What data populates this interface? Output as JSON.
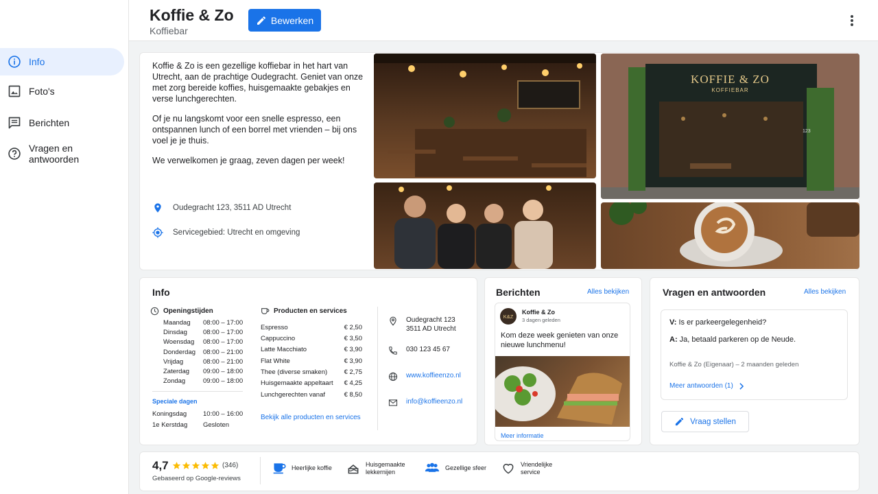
{
  "business": {
    "name": "Koffie & Zo",
    "category": "Koffiebar",
    "edit_label": "Bewerken"
  },
  "sidebar": {
    "items": [
      {
        "label": "Info",
        "icon": "info-icon",
        "active": true
      },
      {
        "label": "Foto's",
        "icon": "photo-icon",
        "active": false
      },
      {
        "label": "Berichten",
        "icon": "posts-icon",
        "active": false
      },
      {
        "label": "Vragen en antwoorden",
        "icon": "help-icon",
        "active": false
      }
    ]
  },
  "about": {
    "paragraph1": "Koffie & Zo is een gezellige koffiebar in het hart van Utrecht, aan de prachtige Oudegracht. Geniet van onze met zorg bereide koffies, huisgemaakte gebakjes en verse lunchgerechten.",
    "paragraph2": "Of je nu langskomt voor een snelle espresso, een ontspannen lunch of een borrel met vrienden – bij ons voel je je thuis.",
    "paragraph3": "We verwelkomen je graag, zeven dagen per week!",
    "address": "Oudegracht 123, 3511 AD Utrecht",
    "service_area": "Servicegebied: Utrecht en omgeving"
  },
  "photos": {
    "interior": "Koffiebar interieur",
    "storefront_sign": "KOFFIE & ZO",
    "storefront_sub": "KOFFIEBAR",
    "storefront_number": "123",
    "team": "Team",
    "coffee": "Cappuccino"
  },
  "info_card": {
    "title": "Info",
    "hours_heading": "Openingstijden",
    "hours": [
      {
        "day": "Maandag",
        "time": "08:00 – 17:00"
      },
      {
        "day": "Dinsdag",
        "time": "08:00 – 17:00"
      },
      {
        "day": "Woensdag",
        "time": "08:00 – 17:00"
      },
      {
        "day": "Donderdag",
        "time": "08:00 – 21:00"
      },
      {
        "day": "Vrijdag",
        "time": "08:00 – 21:00"
      },
      {
        "day": "Zaterdag",
        "time": "09:00 – 18:00"
      },
      {
        "day": "Zondag",
        "time": "09:00 – 18:00"
      }
    ],
    "special_heading": "Speciale dagen",
    "special": [
      {
        "day": "Koningsdag",
        "time": "10:00 – 16:00"
      },
      {
        "day": "1e Kerstdag",
        "time": "Gesloten"
      }
    ],
    "products_heading": "Producten en services",
    "products": [
      {
        "name": "Espresso",
        "price": "€ 2,50"
      },
      {
        "name": "Cappuccino",
        "price": "€ 3,50"
      },
      {
        "name": "Latte Macchiato",
        "price": "€ 3,90"
      },
      {
        "name": "Flat White",
        "price": "€ 3,90"
      },
      {
        "name": "Thee (diverse smaken)",
        "price": "€ 2,75"
      },
      {
        "name": "Huisgemaakte appeltaart",
        "price": "€ 4,25"
      },
      {
        "name": "Lunchgerechten vanaf",
        "price": "€ 8,50"
      }
    ],
    "products_link": "Bekijk alle producten en services",
    "contact": {
      "address_line1": "Oudegracht 123",
      "address_line2": "3511 AD Utrecht",
      "phone": "030 123 45 67",
      "website": "www.koffieenzo.nl",
      "email": "info@koffieenzo.nl"
    }
  },
  "posts_card": {
    "title": "Berichten",
    "view_all": "Alles bekijken",
    "avatar": "K&Z",
    "author": "Koffie & Zo",
    "time": "3 dagen geleden",
    "text": "Kom deze week genieten van onze nieuwe lunchmenu!",
    "more": "Meer informatie"
  },
  "qa_card": {
    "title": "Vragen en antwoorden",
    "view_all": "Alles bekijken",
    "q_label": "V:",
    "question": "Is er parkeergelegenheid?",
    "a_label": "A:",
    "answer": "Ja, betaald parkeren op de Neude.",
    "meta": "Koffie & Zo (Eigenaar) – 2 maanden geleden",
    "more_answers": "Meer antwoorden (1)",
    "ask_label": "Vraag stellen"
  },
  "rating": {
    "score": "4,7",
    "stars": 5,
    "count": "(346)",
    "basis": "Gebaseerd op Google-reviews"
  },
  "attributes": [
    {
      "label": "Heerlijke koffie",
      "icon": "coffee-cup-icon"
    },
    {
      "label": "Huisgemaakte lekkernijen",
      "icon": "cake-icon"
    },
    {
      "label": "Gezellige sfeer",
      "icon": "people-icon"
    },
    {
      "label": "Vriendelijke service",
      "icon": "heart-icon"
    }
  ],
  "colors": {
    "accent": "#1a73e8",
    "star": "#fbbc04"
  }
}
